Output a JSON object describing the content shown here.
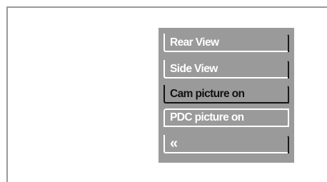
{
  "menu": {
    "items": [
      {
        "label": "Rear View",
        "state": "normal"
      },
      {
        "label": "Side View",
        "state": "normal"
      },
      {
        "label": "Cam picture on",
        "state": "active"
      },
      {
        "label": "PDC picture on",
        "state": "selected"
      }
    ],
    "back": {
      "icon": "double-chevron-left-icon",
      "glyph": "«"
    }
  },
  "colors": {
    "panel_background": "#9a9a9a",
    "text_normal": "#ffffff",
    "text_active": "#111111"
  }
}
